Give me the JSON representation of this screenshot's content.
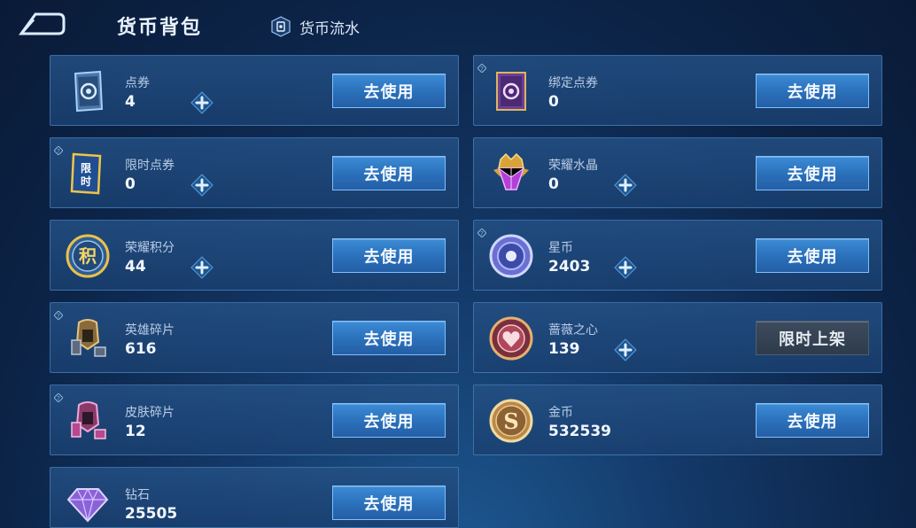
{
  "header": {
    "title": "货币背包",
    "flow_label": "货币流水"
  },
  "colors": {
    "button_blue": "#2a6fb9",
    "button_border": "#7fc0ff",
    "card_bg": "#1f4a80",
    "disabled_button": "#35414f"
  },
  "currencies": [
    {
      "name": "点券",
      "amount": "4",
      "action": "去使用",
      "icon": "ticket-icon"
    },
    {
      "name": "绑定点券",
      "amount": "0",
      "action": "去使用",
      "icon": "bound-ticket-icon"
    },
    {
      "name": "限时点券",
      "amount": "0",
      "action": "去使用",
      "icon": "limited-ticket-icon"
    },
    {
      "name": "荣耀水晶",
      "amount": "0",
      "action": "去使用",
      "icon": "glory-crystal-icon"
    },
    {
      "name": "荣耀积分",
      "amount": "44",
      "action": "去使用",
      "icon": "glory-points-icon"
    },
    {
      "name": "星币",
      "amount": "2403",
      "action": "去使用",
      "icon": "star-coin-icon"
    },
    {
      "name": "英雄碎片",
      "amount": "616",
      "action": "去使用",
      "icon": "hero-fragment-icon"
    },
    {
      "name": "蔷薇之心",
      "amount": "139",
      "action": "限时上架",
      "icon": "rose-heart-icon"
    },
    {
      "name": "皮肤碎片",
      "amount": "12",
      "action": "去使用",
      "icon": "skin-fragment-icon"
    },
    {
      "name": "金币",
      "amount": "532539",
      "action": "去使用",
      "icon": "gold-coin-icon"
    },
    {
      "name": "钻石",
      "amount": "25505",
      "action": "去使用",
      "icon": "diamond-icon"
    }
  ]
}
